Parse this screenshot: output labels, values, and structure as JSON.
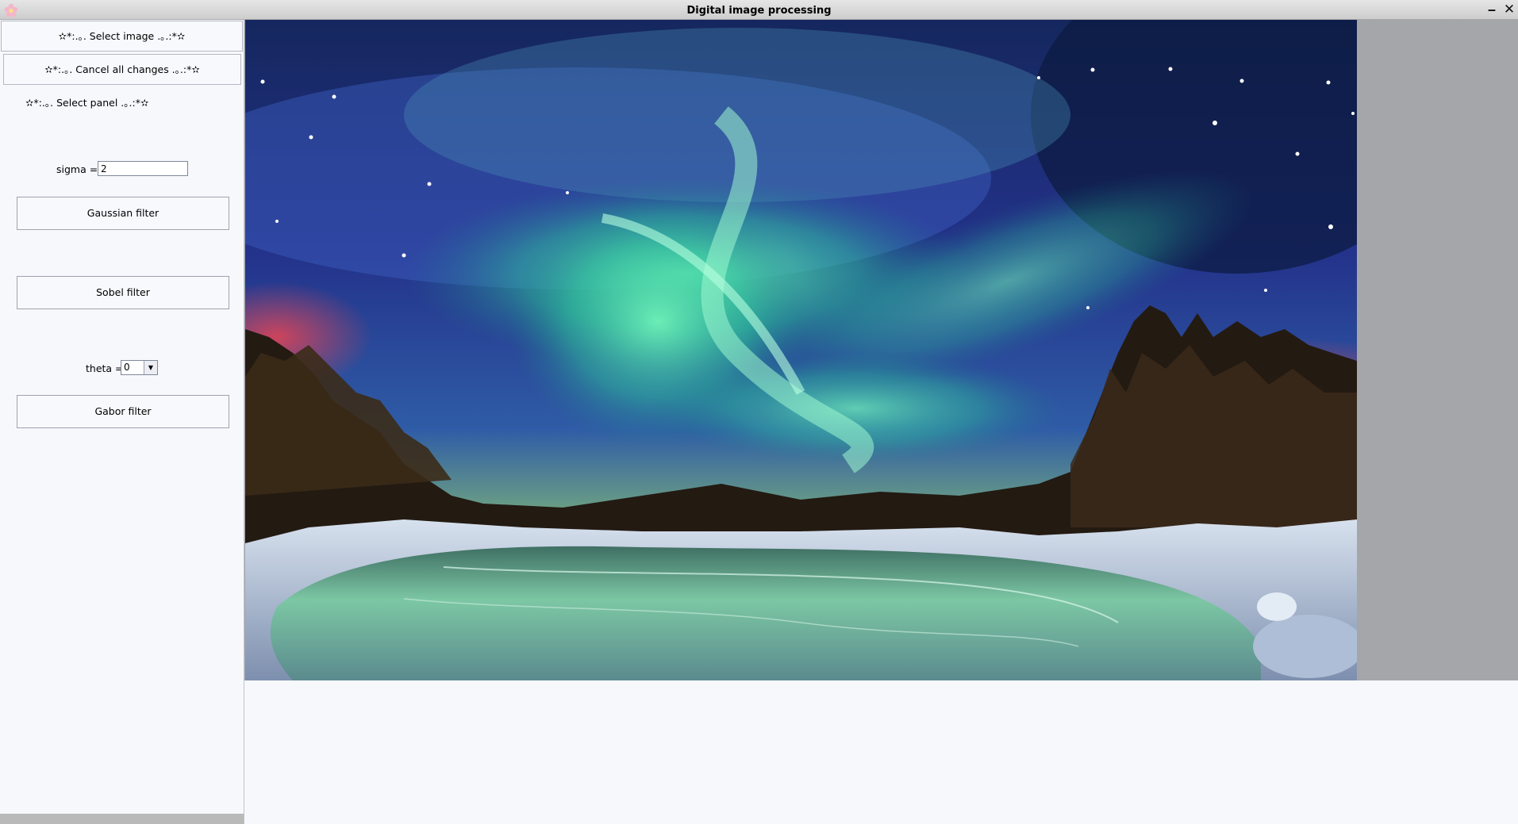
{
  "window": {
    "title": "Digital image processing",
    "minimize_glyph": "‒",
    "close_glyph": "✕",
    "app_icon": "flower-icon"
  },
  "left_panel": {
    "select_image_label": "✫*:.｡. Select image .｡.:*✫",
    "cancel_changes_label": "✫*:.｡. Cancel all changes .｡.:*✫",
    "select_panel_label": "✫*:.｡. Select  panel .｡.:*✫",
    "sigma_label": "sigma =",
    "sigma_value": "2",
    "gaussian_label": "Gaussian filter",
    "sobel_label": "Sobel filter",
    "theta_label": "theta =",
    "theta_value": "0",
    "gabor_label": "Gabor filter"
  },
  "image": {
    "description": "aurora-borealis-over-frozen-lake",
    "colors": {
      "sky_top": "#1b2a6b",
      "aurora": "#4fe6a6",
      "horizon_red": "#c8384a",
      "forest": "#2a1f14",
      "snow": "#b7c6d8",
      "lake": "#6fb59a"
    }
  },
  "colors": {
    "panel_bg": "#f7f8fc",
    "image_area_bg": "#a5a6aa",
    "titlebar": "#d8d8d8"
  }
}
